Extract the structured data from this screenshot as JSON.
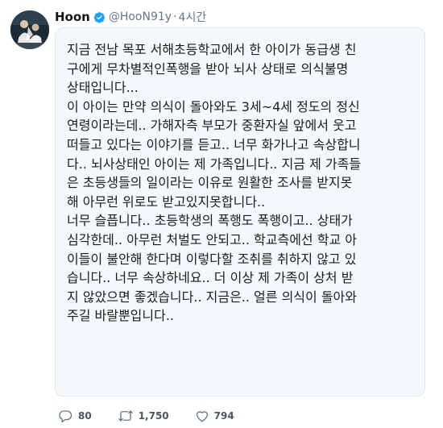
{
  "user": {
    "display_name": "Hoon",
    "handle": "@HooN91y",
    "separator": "·",
    "timestamp": "4시간",
    "verified": true,
    "avatar_icon": "profile-photo"
  },
  "tweet": {
    "lines": [
      "지금 전남 목포 서해초등학교에서 한 아이가 동급생 친",
      "구에게 무차별적인폭행을 받아 뇌사 상태로 의식불명",
      "상태입니다...",
      "이 아이는 만약 의식이 돌아와도 3세~4세 정도의 정신",
      "연령이라는데.. 가해자측 부모가 중환자실 앞에서 웃고",
      "떠들고 있다는 이야기를 듣고.. 너무 화가나고 속상합니",
      "다.. 뇌사상태인 아이는 제 가족입니다.. 지금 제 가족들",
      "은 초등생들의 일이라는 이유로 원활한 조사를 받지못",
      "해 아무런 위로도 받고있지못합니다..",
      "너무 슬픕니다.. 초등학생의 폭행도 폭행이고.. 상태가",
      "심각한데.. 아무런 처벌도 안되고.. 학교측에선 학교 아",
      "이들이 불안해 한다며 이렇다할 조취를 취하지 않고 있",
      "습니다.. 너무 속상하네요.. 더 이상 제 가족이 상처 받",
      "지 않았으면 좋겠습니다.. 지금은.. 얼른 의식이 돌아와",
      "주길 바랄뿐입니다.."
    ]
  },
  "actions": {
    "reply": {
      "icon": "reply-icon",
      "count": "80"
    },
    "retweet": {
      "icon": "retweet-icon",
      "count": "1,750"
    },
    "like": {
      "icon": "heart-icon",
      "count": "794"
    }
  },
  "colors": {
    "verified_badge": "#1da1f2",
    "secondary_text": "#657786",
    "card_background": "#f5f8fa"
  }
}
